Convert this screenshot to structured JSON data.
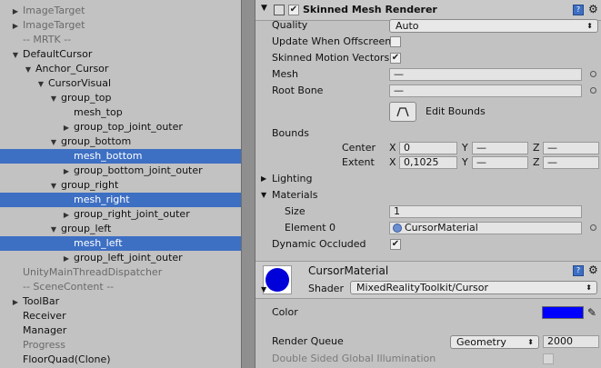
{
  "hierarchy": [
    {
      "label": "ImageTarget",
      "arrow": "▶",
      "indent": 1,
      "dim": true,
      "sel": false
    },
    {
      "label": "ImageTarget",
      "arrow": "▶",
      "indent": 1,
      "dim": true,
      "sel": false
    },
    {
      "label": "-- MRTK --",
      "arrow": "",
      "indent": 1,
      "dim": true,
      "sel": false
    },
    {
      "label": "DefaultCursor",
      "arrow": "▼",
      "indent": 1,
      "dim": false,
      "sel": false
    },
    {
      "label": "Anchor_Cursor",
      "arrow": "▼",
      "indent": 2,
      "dim": false,
      "sel": false
    },
    {
      "label": "CursorVisual",
      "arrow": "▼",
      "indent": 3,
      "dim": false,
      "sel": false
    },
    {
      "label": "group_top",
      "arrow": "▼",
      "indent": 4,
      "dim": false,
      "sel": false
    },
    {
      "label": "mesh_top",
      "arrow": "",
      "indent": 5,
      "dim": false,
      "sel": false
    },
    {
      "label": "group_top_joint_outer",
      "arrow": "▶",
      "indent": 5,
      "dim": false,
      "sel": false
    },
    {
      "label": "group_bottom",
      "arrow": "▼",
      "indent": 4,
      "dim": false,
      "sel": false
    },
    {
      "label": "mesh_bottom",
      "arrow": "",
      "indent": 5,
      "dim": false,
      "sel": true
    },
    {
      "label": "group_bottom_joint_outer",
      "arrow": "▶",
      "indent": 5,
      "dim": false,
      "sel": false
    },
    {
      "label": "group_right",
      "arrow": "▼",
      "indent": 4,
      "dim": false,
      "sel": false
    },
    {
      "label": "mesh_right",
      "arrow": "",
      "indent": 5,
      "dim": false,
      "sel": true
    },
    {
      "label": "group_right_joint_outer",
      "arrow": "▶",
      "indent": 5,
      "dim": false,
      "sel": false
    },
    {
      "label": "group_left",
      "arrow": "▼",
      "indent": 4,
      "dim": false,
      "sel": false
    },
    {
      "label": "mesh_left",
      "arrow": "",
      "indent": 5,
      "dim": false,
      "sel": true
    },
    {
      "label": "group_left_joint_outer",
      "arrow": "▶",
      "indent": 5,
      "dim": false,
      "sel": false
    },
    {
      "label": "UnityMainThreadDispatcher",
      "arrow": "",
      "indent": 1,
      "dim": true,
      "sel": false
    },
    {
      "label": "-- SceneContent --",
      "arrow": "",
      "indent": 1,
      "dim": true,
      "sel": false
    },
    {
      "label": "ToolBar",
      "arrow": "▶",
      "indent": 1,
      "dim": false,
      "sel": false
    },
    {
      "label": "Receiver",
      "arrow": "",
      "indent": 1,
      "dim": false,
      "sel": false
    },
    {
      "label": "Manager",
      "arrow": "",
      "indent": 1,
      "dim": false,
      "sel": false
    },
    {
      "label": "Progress",
      "arrow": "",
      "indent": 1,
      "dim": true,
      "sel": false
    },
    {
      "label": "FloorQuad(Clone)",
      "arrow": "",
      "indent": 1,
      "dim": false,
      "sel": false
    }
  ],
  "renderer": {
    "title": "Skinned Mesh Renderer",
    "quality_label": "Quality",
    "quality_value": "Auto",
    "update_offscreen_label": "Update When Offscreen",
    "motion_vectors_label": "Skinned Motion Vectors",
    "mesh_label": "Mesh",
    "mesh_value": "—",
    "root_bone_label": "Root Bone",
    "root_bone_value": "—",
    "edit_bounds_label": "Edit Bounds",
    "bounds_label": "Bounds",
    "center_label": "Center",
    "extent_label": "Extent",
    "x": "X",
    "y": "Y",
    "z": "Z",
    "center_x": "0",
    "center_y": "—",
    "center_z": "—",
    "extent_x": "0,1025",
    "extent_y": "—",
    "extent_z": "—",
    "lighting_label": "Lighting",
    "materials_label": "Materials",
    "size_label": "Size",
    "size_value": "1",
    "element0_label": "Element 0",
    "element0_value": "CursorMaterial",
    "dynamic_occluded_label": "Dynamic Occluded"
  },
  "material": {
    "name": "CursorMaterial",
    "shader_label": "Shader",
    "shader_value": "MixedRealityToolkit/Cursor",
    "color_label": "Color",
    "color_value": "#0000ff",
    "render_queue_label": "Render Queue",
    "render_queue_mode": "Geometry",
    "render_queue_value": "2000",
    "double_sided_label": "Double Sided Global Illumination"
  }
}
